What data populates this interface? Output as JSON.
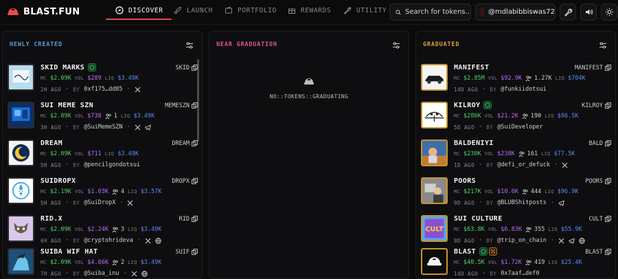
{
  "brand": {
    "name": "BLAST.FUN",
    "accent": "#e84a4a"
  },
  "nav": {
    "tabs": [
      {
        "label": "DISCOVER",
        "icon": "compass-icon",
        "active": true
      },
      {
        "label": "LAUNCH",
        "icon": "rocket-icon",
        "active": false
      },
      {
        "label": "PORTFOLIO",
        "icon": "wallet-icon",
        "active": false
      },
      {
        "label": "REWARDS",
        "icon": "gift-icon",
        "active": false
      },
      {
        "label": "UTILITY",
        "icon": "wrench-icon",
        "active": false
      }
    ],
    "search_placeholder": "Search for tokens...",
    "user": "@mdlabibbiswas72",
    "icons": [
      "settings-icon",
      "volume-icon",
      "theme-sun-icon"
    ]
  },
  "columns": {
    "newly_created": {
      "title": "NEWLY CREATED",
      "color": "#5b9bd5",
      "tokens": [
        {
          "name": "SKID MARKS",
          "ticker": "SKID",
          "mc": "$2.09K",
          "vol": "$289",
          "holders": "",
          "liq": "$3.49K",
          "age": "2H AGO",
          "by": "0xf175…dd85",
          "badges": [
            "verified"
          ],
          "socials": [
            "x"
          ]
        },
        {
          "name": "SUI MEME SZN",
          "ticker": "MEMESZN",
          "mc": "$2.09K",
          "vol": "$738",
          "holders": "1",
          "liq": "$3.49K",
          "age": "3H AGO",
          "by": "@SuiMemeSZN",
          "badges": [],
          "socials": [
            "x",
            "telegram"
          ]
        },
        {
          "name": "DREAM",
          "ticker": "DREAM",
          "mc": "$2.09K",
          "vol": "$711",
          "holders": "",
          "liq": "$3.49K",
          "age": "5H AGO",
          "by": "@pencilgondotsui",
          "badges": [],
          "socials": []
        },
        {
          "name": "SUIDROPX",
          "ticker": "DROPX",
          "mc": "$2.19K",
          "vol": "$1.03K",
          "holders": "4",
          "liq": "$3.57K",
          "age": "5H AGO",
          "by": "@SuiDropX",
          "badges": [],
          "socials": [
            "x"
          ]
        },
        {
          "name": "RID.X",
          "ticker": "RID",
          "mc": "$2.09K",
          "vol": "$2.24K",
          "holders": "3",
          "liq": "$3.49K",
          "age": "6H AGO",
          "by": "@cryptohrideva",
          "badges": [],
          "socials": [
            "x",
            "web"
          ]
        },
        {
          "name": "SUIBA WIF HAT",
          "ticker": "SUIF",
          "mc": "$2.09K",
          "vol": "$4.66K",
          "holders": "2",
          "liq": "$3.49K",
          "age": "7H AGO",
          "by": "@Suiba_inu",
          "badges": [],
          "socials": [
            "x",
            "web"
          ]
        }
      ]
    },
    "near_graduation": {
      "title": "NEAR GRADUATION",
      "color": "#e0568a",
      "empty_text": "NO::TOKENS::GRADUATING",
      "empty_icon": "helmet-icon"
    },
    "graduated": {
      "title": "GRADUATED",
      "color": "#d9a23a",
      "tokens": [
        {
          "name": "MANIFEST",
          "ticker": "MANIFEST",
          "mc": "$2.85M",
          "vol": "$92.9K",
          "holders": "1.27K",
          "liq": "$704K",
          "age": "14D AGO",
          "by": "@funkiidotsui",
          "badges": [],
          "socials": []
        },
        {
          "name": "KILROY",
          "ticker": "KILROY",
          "mc": "$286K",
          "vol": "$21.2K",
          "holders": "190",
          "liq": "$96.5K",
          "age": "5D AGO",
          "by": "@SuiDeveloper",
          "badges": [
            "verified"
          ],
          "socials": []
        },
        {
          "name": "BALDENIYI",
          "ticker": "BALD",
          "mc": "$230K",
          "vol": "$238K",
          "holders": "161",
          "liq": "$77.5K",
          "age": "1D AGO",
          "by": "@defi_or_defuck",
          "badges": [],
          "socials": [
            "x"
          ]
        },
        {
          "name": "POORS",
          "ticker": "POORS",
          "mc": "$217K",
          "vol": "$10.6K",
          "holders": "444",
          "liq": "$96.9K",
          "age": "9D AGO",
          "by": "@BLUBShitposts",
          "badges": [],
          "socials": [
            "telegram"
          ]
        },
        {
          "name": "SUI CULTURE",
          "ticker": "CULT",
          "mc": "$63.8K",
          "vol": "$6.83K",
          "holders": "355",
          "liq": "$55.9K",
          "age": "9D AGO",
          "by": "@trip_on_chain",
          "badges": [],
          "socials": [
            "x",
            "telegram",
            "web"
          ]
        },
        {
          "name": "BLAST",
          "ticker": "BLAST",
          "mc": "$40.5K",
          "vol": "$1.72K",
          "holders": "419",
          "liq": "$25.4K",
          "age": "14D AGO",
          "by": "0x7aaf…def0",
          "badges": [
            "verified",
            "percent"
          ],
          "socials": []
        }
      ]
    }
  },
  "labels": {
    "mc": "MC",
    "vol": "VOL",
    "liq": "LIQ",
    "by": "BY"
  }
}
